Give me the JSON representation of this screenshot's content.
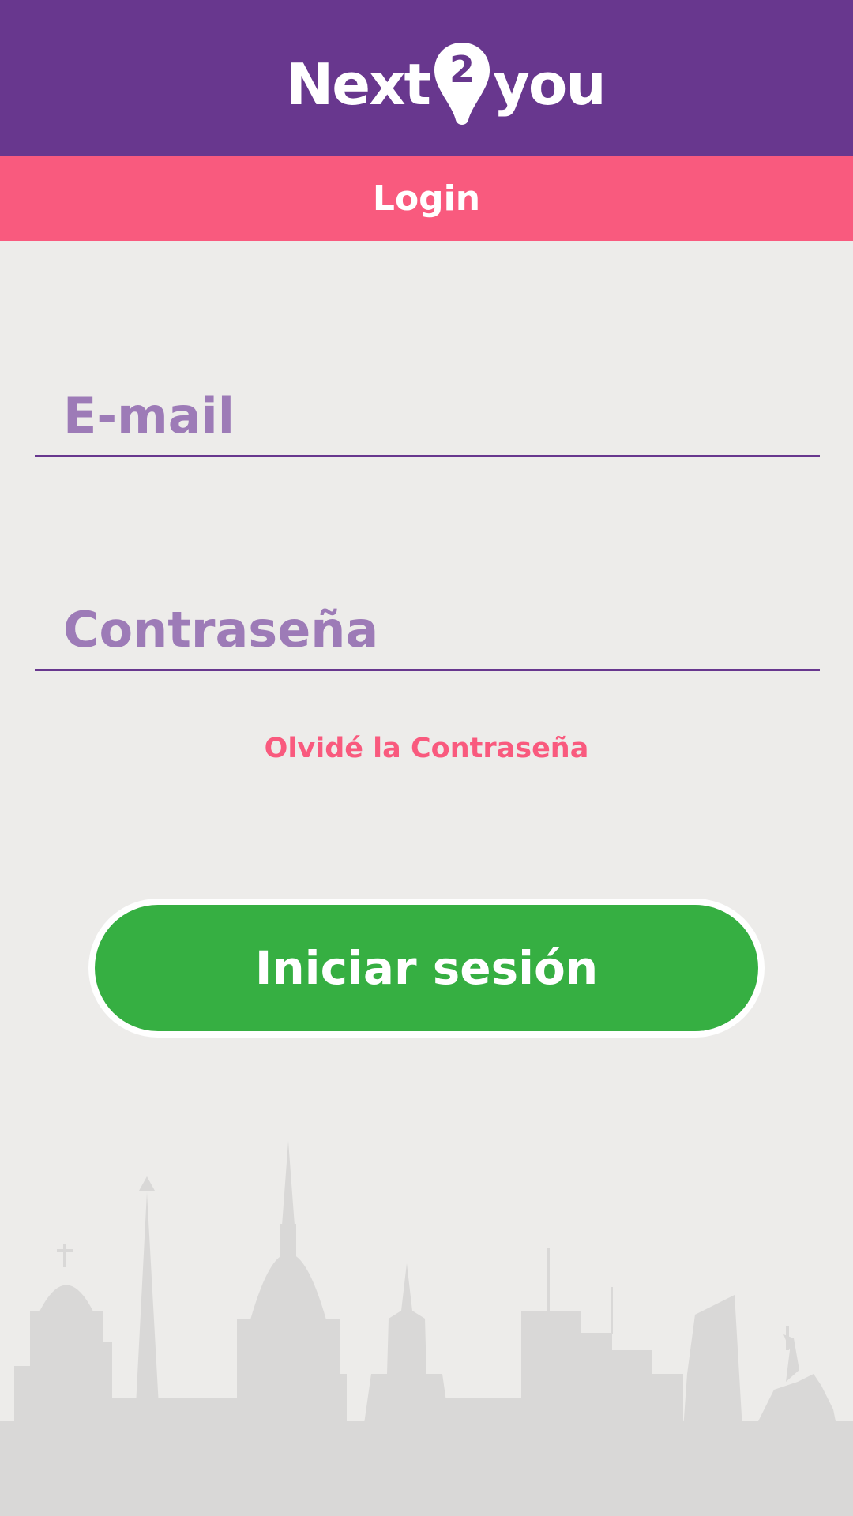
{
  "header": {
    "logo": {
      "part1": "Next",
      "digit": "2",
      "part2": "you"
    },
    "title": "Login"
  },
  "form": {
    "email": {
      "placeholder": "E-mail",
      "value": ""
    },
    "password": {
      "placeholder": "Contraseña",
      "value": ""
    },
    "forgot_label": "Olvidé la Contraseña",
    "submit_label": "Iniciar sesión"
  },
  "colors": {
    "header_bg": "#68378e",
    "title_bar_bg": "#f95a7e",
    "page_bg": "#edecea",
    "accent": "#f95a7e",
    "primary_button": "#36af42",
    "placeholder": "#9d7bb7",
    "skyline": "#d9d8d7"
  },
  "background": {
    "image": "city-skyline-silhouette"
  }
}
